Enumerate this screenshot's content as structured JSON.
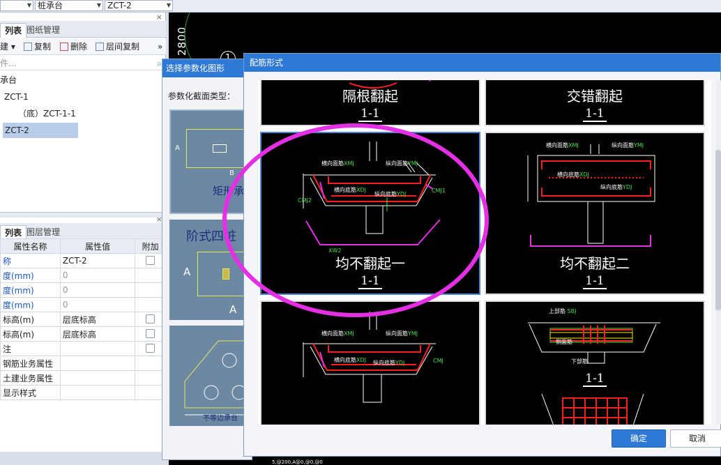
{
  "topbar": {
    "combo1": "",
    "combo2": "桩承台",
    "combo3": "ZCT-2"
  },
  "left_top": {
    "tabs": [
      "列表",
      "图纸管理"
    ],
    "toolbar": {
      "new": "建",
      "copy": "复制",
      "delete": "删除",
      "floor_copy": "层间复制",
      "more": "»"
    },
    "search_placeholder": "件...",
    "tree": [
      {
        "label": "承台",
        "indent": 0
      },
      {
        "label": "ZCT-1",
        "indent": 1
      },
      {
        "label": "（底）ZCT-1-1",
        "indent": 2
      },
      {
        "label": "ZCT-2",
        "indent": 1,
        "selected": true
      }
    ]
  },
  "left_bottom": {
    "tabs": [
      "列表",
      "图层管理"
    ],
    "headers": [
      "属性名称",
      "属性值",
      "附加"
    ],
    "rows": [
      {
        "name": "称",
        "value": "ZCT-2",
        "check": true,
        "blue": true,
        "grey": false
      },
      {
        "name": "度(mm)",
        "value": "0",
        "check": false,
        "blue": true,
        "grey": true
      },
      {
        "name": "度(mm)",
        "value": "0",
        "check": false,
        "blue": true,
        "grey": true
      },
      {
        "name": "度(mm)",
        "value": "0",
        "check": false,
        "blue": true,
        "grey": true
      },
      {
        "name": "标高(m)",
        "value": "层底标高",
        "check": true,
        "blue": false,
        "grey": false
      },
      {
        "name": "标高(m)",
        "value": "层底标高",
        "check": true,
        "blue": false,
        "grey": false
      },
      {
        "name": "注",
        "value": "",
        "check": true,
        "blue": false,
        "grey": false
      },
      {
        "name": "钢筋业务属性",
        "value": "",
        "check": false,
        "blue": false,
        "grey": false
      },
      {
        "name": "土建业务属性",
        "value": "",
        "check": false,
        "blue": false,
        "grey": false
      },
      {
        "name": "显示样式",
        "value": "",
        "check": false,
        "blue": false,
        "grey": false
      }
    ]
  },
  "cad": {
    "dim": "2800",
    "mark": "1",
    "bottom_text": "5,@200,A@0,@0,@0"
  },
  "select_dialog": {
    "title": "选择参数化图形",
    "type_label": "参数化截面类型：",
    "thumbs": [
      {
        "label": "矩形承台",
        "dim_a": "A",
        "dim_b": "B"
      },
      {
        "label": "阶式四桩",
        "dim_a": "A"
      },
      {
        "label": "不等边承台"
      }
    ]
  },
  "main_dialog": {
    "title": "配筋形式",
    "cells": [
      {
        "caption": "隔根翻起",
        "section": "1-1"
      },
      {
        "caption": "交错翻起",
        "section": "1-1"
      },
      {
        "caption": "均不翻起一",
        "section": "1-1"
      },
      {
        "caption": "均不翻起二",
        "section": "1-1"
      },
      {
        "caption": "",
        "section": ""
      },
      {
        "caption": "",
        "section": "1-1"
      }
    ],
    "labels": {
      "hmj": "横向面筋",
      "zmj": "纵向面筋",
      "hdj": "横向底筋",
      "zdj": "纵向底筋",
      "cmj": "CMJ",
      "cmj1": "CMJ1",
      "cmj2": "CMJ2",
      "xw2": "XW2",
      "xmj": "XMJ",
      "ymj": "YMJ",
      "xdj": "XDJ",
      "ydj": "YDJ",
      "sbj": "SBJ",
      "sbj_label": "上部筋",
      "xbj_label": "下部筋",
      "ce_label": "侧面筋"
    },
    "ok": "确定",
    "cancel": "取消"
  },
  "colors": {
    "title_bar": "#2f79d6",
    "annotation": "#e52fe5",
    "rebar": "#ff2020",
    "green_text": "#46e046"
  }
}
